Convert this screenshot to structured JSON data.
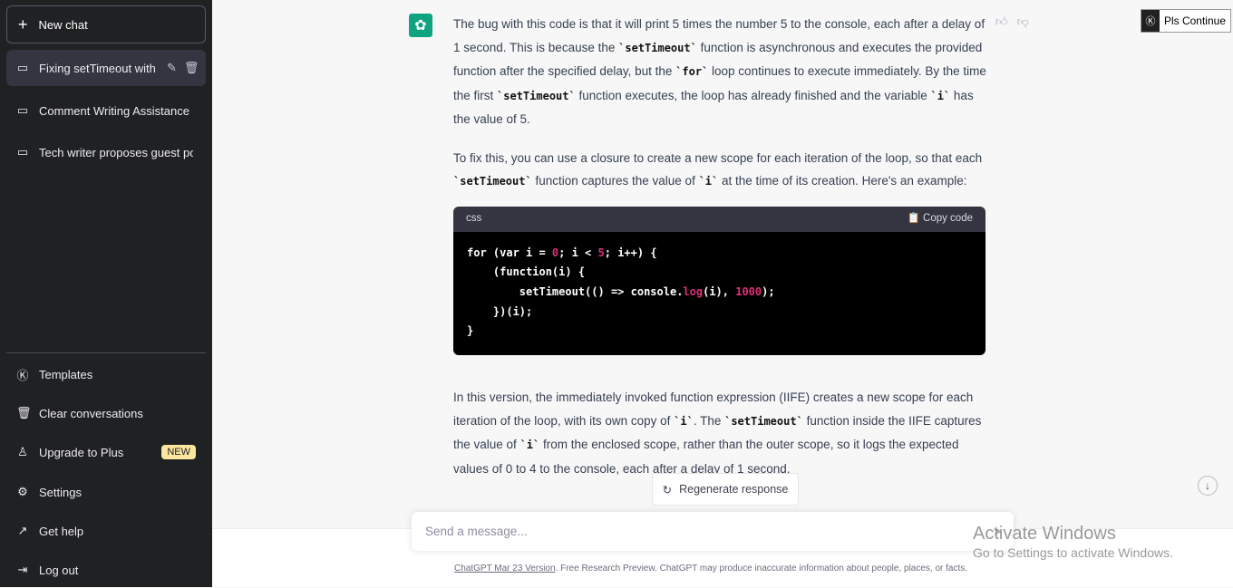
{
  "sidebar": {
    "new_chat": "New chat",
    "conversations": [
      {
        "label": "Fixing setTimeout with"
      },
      {
        "label": "Comment Writing Assistance"
      },
      {
        "label": "Tech writer proposes guest po"
      }
    ],
    "bottom": [
      {
        "label": "Templates",
        "icon": "k-icon"
      },
      {
        "label": "Clear conversations",
        "icon": "trash-icon"
      },
      {
        "label": "Upgrade to Plus",
        "icon": "user-icon",
        "badge": "NEW"
      },
      {
        "label": "Settings",
        "icon": "gear-icon"
      },
      {
        "label": "Get help",
        "icon": "external-link-icon"
      },
      {
        "label": "Log out",
        "icon": "logout-icon"
      }
    ]
  },
  "message": {
    "p1": [
      "The bug with this code is that it will print 5 times the number 5 to the console, each after a delay of 1 second. This is because the ",
      "`setTimeout`",
      " function is asynchronous and executes the provided function after the specified delay, but the ",
      "`for`",
      " loop continues to execute immediately. By the time the first ",
      "`setTimeout`",
      " function executes, the loop has already finished and the variable ",
      "`i`",
      " has the value of 5."
    ],
    "p2": [
      "To fix this, you can use a closure to create a new scope for each iteration of the loop, so that each ",
      "`setTimeout`",
      " function captures the value of ",
      "`i`",
      " at the time of its creation. Here's an example:"
    ],
    "code": {
      "lang": "css",
      "copy": "Copy code",
      "lines": [
        [
          "for (var i = ",
          "0",
          "; i < ",
          "5",
          "; i++) {"
        ],
        [
          "    (function(i) {"
        ],
        [
          "        setTimeout(() => console.",
          "log",
          "(i), ",
          "1000",
          ");"
        ],
        [
          "    })(i);"
        ],
        [
          "}"
        ]
      ]
    },
    "p3": [
      "In this version, the immediately invoked function expression (IIFE) creates a new scope for each iteration of the loop, with its own copy of ",
      "`i`",
      ". The ",
      "`setTimeout`",
      " function inside the IIFE captures the value of ",
      "`i`",
      " from the enclosed scope, rather than the outer scope, so it logs the expected values of 0 to 4 to the console, each after a delay of 1 second."
    ]
  },
  "extension": {
    "label": "Pls Continue"
  },
  "regenerate": "Regenerate response",
  "input": {
    "placeholder": "Send a message..."
  },
  "footer": {
    "link": "ChatGPT Mar 23 Version",
    "text": ". Free Research Preview. ChatGPT may produce inaccurate information about people, places, or facts."
  },
  "watermark": {
    "title": "Activate Windows",
    "subtitle": "Go to Settings to activate Windows."
  },
  "colors": {
    "sidebar": "#202123",
    "accent": "#10a37f",
    "code_bg": "#000000",
    "number": "#df3079"
  }
}
